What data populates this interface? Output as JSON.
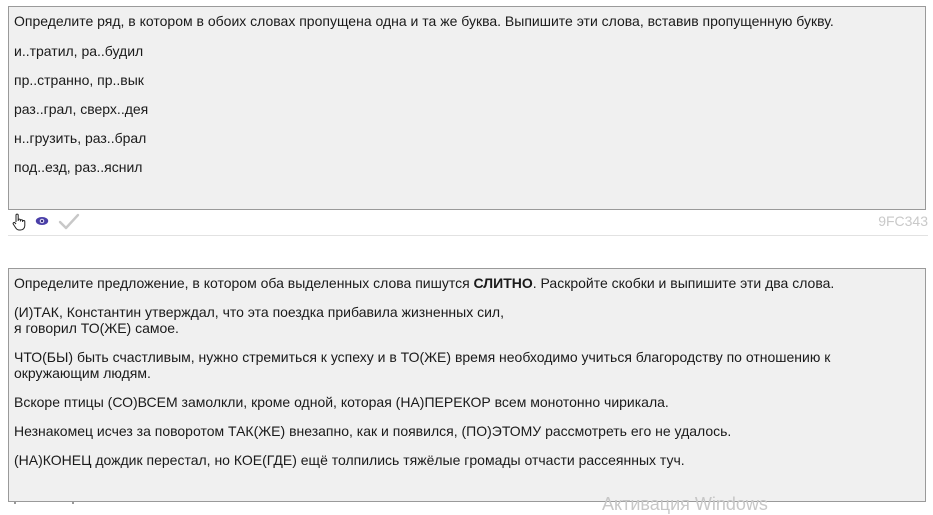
{
  "task1": {
    "question": "Определите ряд, в котором в обоих словах пропущена одна и та же буква. Выпишите эти слова, вставив пропущенную букву.",
    "options": [
      "и..тратил, ра..будил",
      "пр..странно, пр..вык",
      "раз..грал, сверх..дея",
      "н..грузить, раз..брал",
      "под..езд, раз..яснил"
    ]
  },
  "toolbar": {
    "icons": [
      "hand-pointer-icon",
      "eye-icon",
      "checkmark-icon"
    ],
    "task_id": "9FC343"
  },
  "task2": {
    "question_before": "Определите предложение, в котором оба выделенных слова пишутся ",
    "question_bold": "СЛИТНО",
    "question_after": ". Раскройте скобки и выпишите эти два слова.",
    "sentences": [
      {
        "line1": "(И)ТАК, Константин утверждал, что эта поездка прибавила жизненных сил,",
        "line2": "я говорил ТО(ЖЕ) самое."
      },
      {
        "line1": "ЧТО(БЫ) быть счастливым, нужно стремиться к успеху и в ТО(ЖЕ) время необходимо учиться благородству по отношению к",
        "line2": "окружающим людям."
      },
      {
        "line1": "Вскоре птицы (СО)ВСЕМ замолкли, кроме одной, которая (НА)ПЕРЕКОР всем монотонно чирикала."
      },
      {
        "line1": "Незнакомец исчез за поворотом ТАК(ЖЕ) внезапно, как и появился, (ПО)ЭТОМУ рассмотреть его не удалось."
      },
      {
        "line1": "(НА)КОНЕЦ дождик перестал, но КОЕ(ГДЕ) ещё толпились тяжёлые громады отчасти рассеянных туч."
      }
    ]
  },
  "watermark": "Активация Windows",
  "colors": {
    "panel_bg": "#f0f0f0",
    "panel_border": "#9a9a9a",
    "eye_icon": "#4a3fa8",
    "check_icon": "#c8c8c8",
    "task_id": "#c9c9c9"
  }
}
